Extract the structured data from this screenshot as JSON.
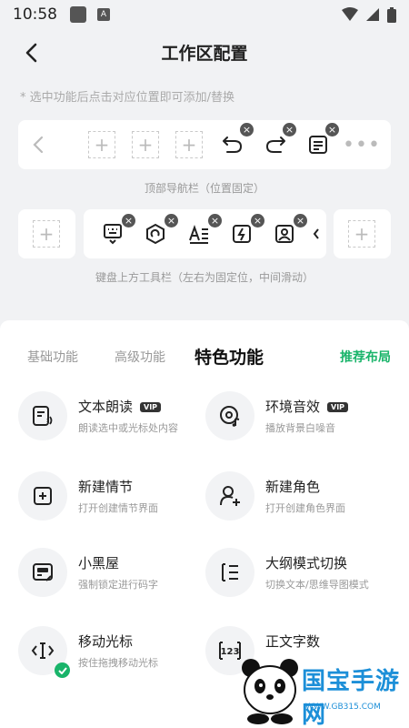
{
  "status_bar": {
    "time": "10:58"
  },
  "header": {
    "title": "工作区配置"
  },
  "hint": "* 选中功能后点击对应位置即可添加/替换",
  "top_nav": {
    "caption": "顶部导航栏（位置固定）"
  },
  "keyboard_toolbar": {
    "caption": "键盘上方工具栏（左右为固定位，中间滑动）"
  },
  "tabs": [
    {
      "label": "基础功能"
    },
    {
      "label": "高级功能"
    },
    {
      "label": "特色功能"
    }
  ],
  "recommend_label": "推荐布局",
  "features": [
    {
      "title": "文本朗读",
      "badge": "VIP",
      "desc": "朗读选中或光标处内容",
      "icon": "speech-doc-icon"
    },
    {
      "title": "环境音效",
      "badge": "VIP",
      "desc": "播放背景白噪音",
      "icon": "music-disc-icon"
    },
    {
      "title": "新建情节",
      "desc": "打开创建情节界面",
      "icon": "add-box-icon"
    },
    {
      "title": "新建角色",
      "desc": "打开创建角色界面",
      "icon": "add-person-icon"
    },
    {
      "title": "小黑屋",
      "desc": "强制锁定进行码字",
      "icon": "dark-room-icon"
    },
    {
      "title": "大纲模式切换",
      "desc": "切换文本/思维导图模式",
      "icon": "outline-list-icon"
    },
    {
      "title": "移动光标",
      "desc": "按住拖拽移动光标",
      "icon": "move-cursor-icon"
    },
    {
      "title": "正文字数",
      "desc": "",
      "icon": "word-count-icon"
    }
  ],
  "watermark": {
    "text": "国宝手游网",
    "url": "WWW.GB315.COM"
  },
  "colors": {
    "accent": "#19b46a",
    "background": "#f1f2f4"
  }
}
